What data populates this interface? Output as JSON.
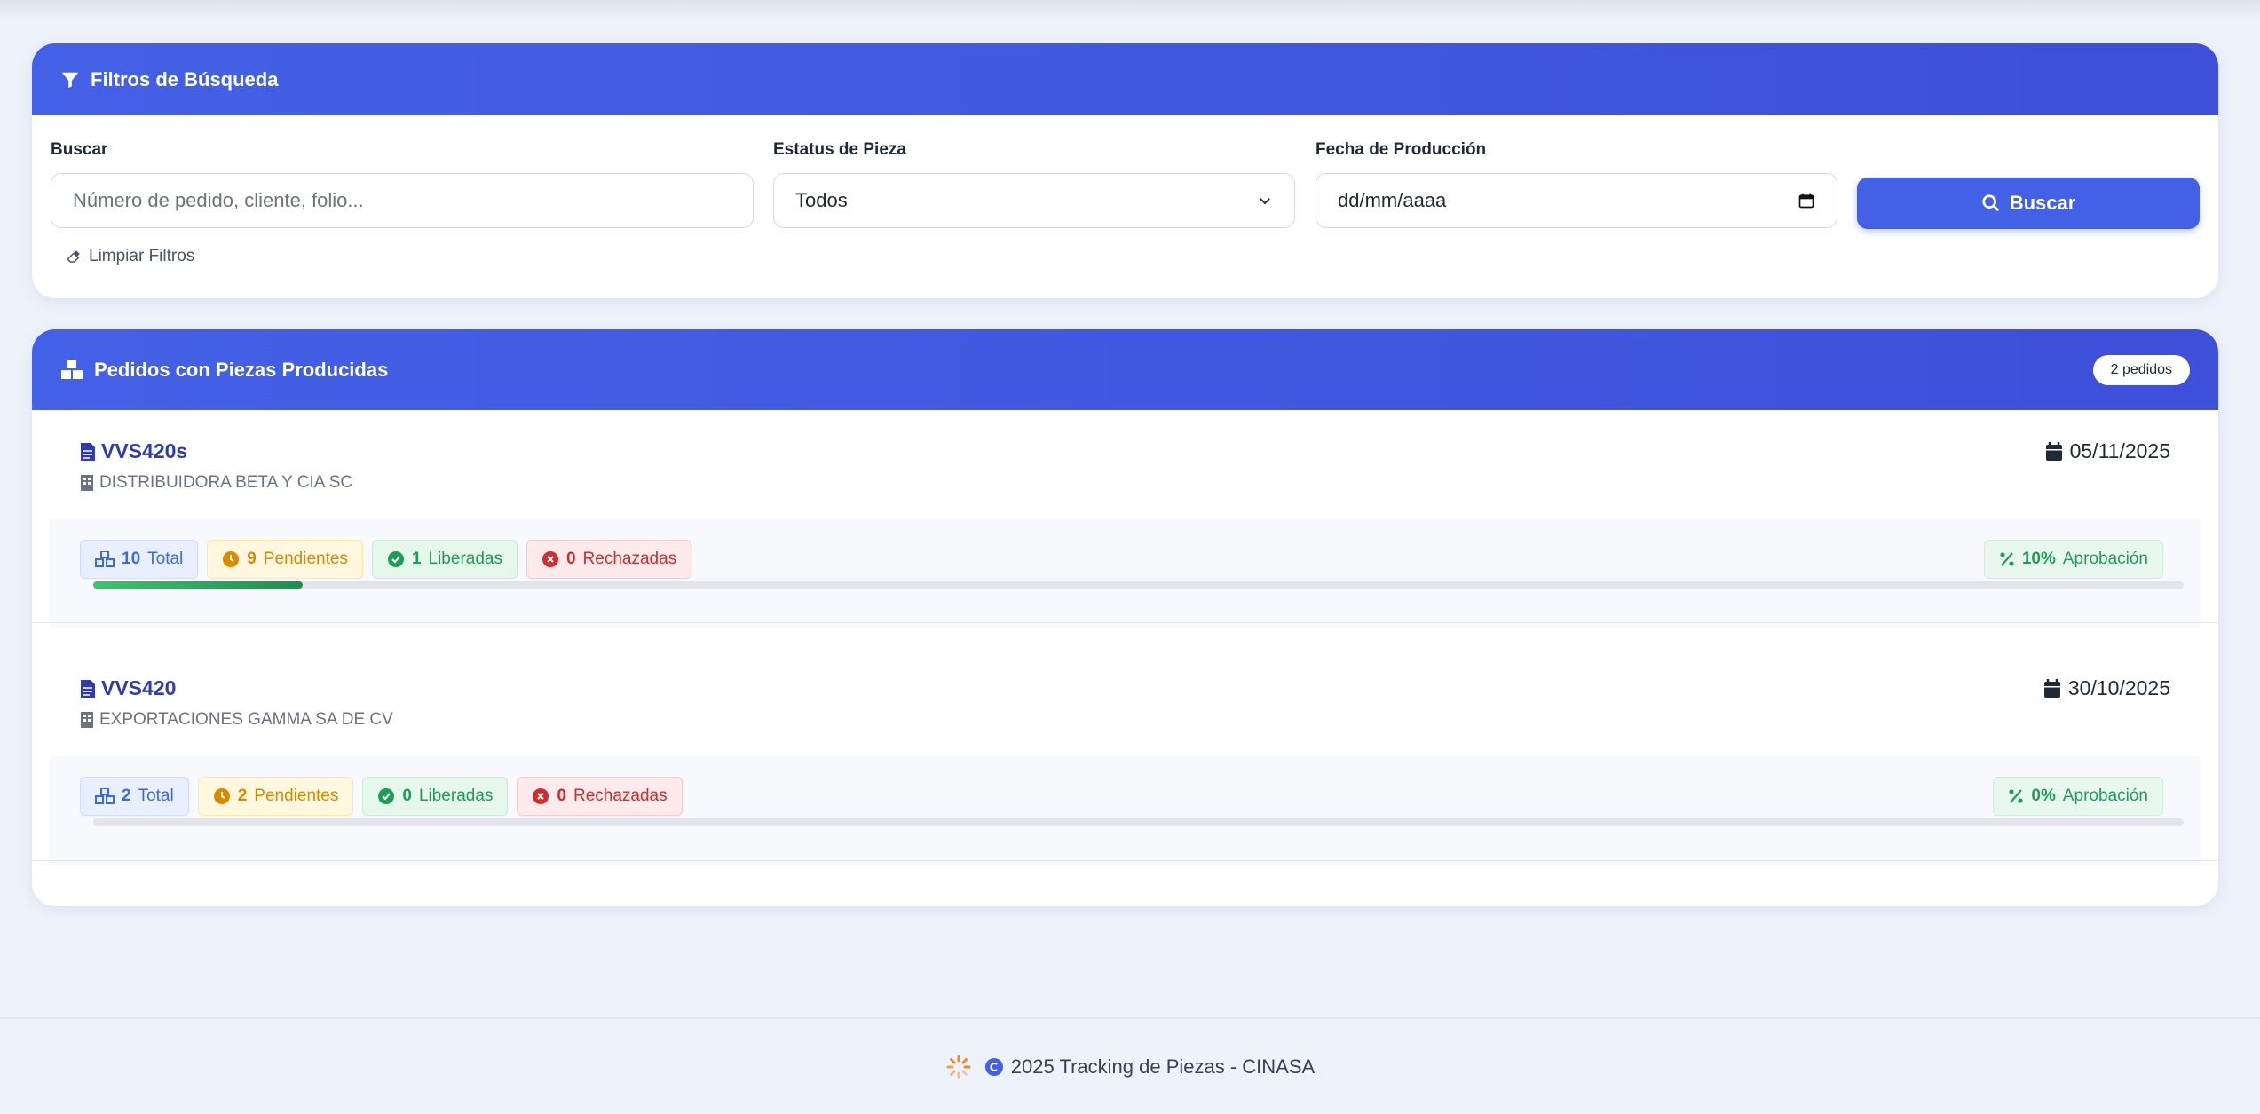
{
  "filters": {
    "title": "Filtros de Búsqueda",
    "search_label": "Buscar",
    "search_placeholder": "Número de pedido, cliente, folio...",
    "status_label": "Estatus de Pieza",
    "status_value": "Todos",
    "date_label": "Fecha de Producción",
    "date_placeholder": "dd/mm/aaaa",
    "search_button": "Buscar",
    "clear_button": "Limpiar Filtros"
  },
  "orders": {
    "title": "Pedidos con Piezas Producidas",
    "count_badge": "2 pedidos",
    "items": [
      {
        "id": "VVS420s",
        "client": "DISTRIBUIDORA BETA Y CIA SC",
        "date": "05/11/2025",
        "total_count": "10",
        "total_label": "Total",
        "pending_count": "9",
        "pending_label": "Pendientes",
        "released_count": "1",
        "released_label": "Liberadas",
        "rejected_count": "0",
        "rejected_label": "Rechazadas",
        "approval_value": "10%",
        "approval_label": "Aprobación",
        "progress": 0.1
      },
      {
        "id": "VVS420",
        "client": "EXPORTACIONES GAMMA SA DE CV",
        "date": "30/10/2025",
        "total_count": "2",
        "total_label": "Total",
        "pending_count": "2",
        "pending_label": "Pendientes",
        "released_count": "0",
        "released_label": "Liberadas",
        "rejected_count": "0",
        "rejected_label": "Rechazadas",
        "approval_value": "0%",
        "approval_label": "Aprobación",
        "progress": 0.0
      }
    ]
  },
  "footer": {
    "text": "2025 Tracking de Piezas - CINASA"
  },
  "colors": {
    "primary": "#4361e6",
    "order_id": "#2d3bb5",
    "success": "#1f9d55",
    "warning": "#d88a00",
    "danger": "#d22c2c"
  }
}
